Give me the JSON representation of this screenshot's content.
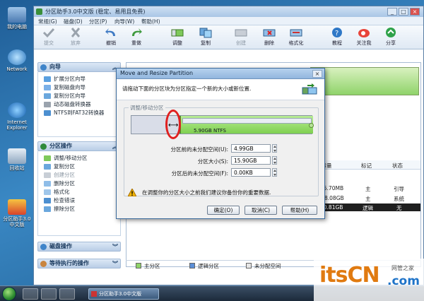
{
  "desktop": {
    "icons": [
      {
        "label": "我的电脑",
        "icon": "computer-icon"
      },
      {
        "label": "Network",
        "icon": "network-icon"
      },
      {
        "label": "Internet Explorer",
        "icon": "ie-icon"
      },
      {
        "label": "回收站",
        "icon": "recycle-bin-icon"
      },
      {
        "label": "分区助手3.0中文版",
        "icon": "partition-assistant-icon"
      }
    ]
  },
  "taskbar": {
    "app_label": "分区助手3.0中文版"
  },
  "app": {
    "title": "分区助手3.0中文版 (稳定、易用且免费)",
    "menu": [
      "常规(G)",
      "磁盘(D)",
      "分区(P)",
      "向导(W)",
      "帮助(H)"
    ],
    "toolbar": [
      {
        "label": "提交",
        "enabled": false
      },
      {
        "label": "放弃",
        "enabled": false
      },
      {
        "label": "撤销",
        "enabled": true
      },
      {
        "label": "重做",
        "enabled": true
      },
      {
        "label": "调整",
        "enabled": true
      },
      {
        "label": "复制",
        "enabled": true
      },
      {
        "label": "创建",
        "enabled": false
      },
      {
        "label": "删除",
        "enabled": true
      },
      {
        "label": "格式化",
        "enabled": true
      },
      {
        "label": "教程",
        "enabled": true
      },
      {
        "label": "关注我",
        "enabled": true
      },
      {
        "label": "分享",
        "enabled": true
      }
    ],
    "sidebar": {
      "wizard_header": "向导",
      "wizard_items": [
        "扩展分区向导",
        "复制磁盘向导",
        "复制分区向导",
        "动态磁盘转换器",
        "NTFS到FAT32转换器"
      ],
      "ops_header": "分区操作",
      "ops_items": [
        {
          "label": "调整/移动分区",
          "enabled": true
        },
        {
          "label": "复制分区",
          "enabled": true
        },
        {
          "label": "创建分区",
          "enabled": false
        },
        {
          "label": "删除分区",
          "enabled": true
        },
        {
          "label": "格式化",
          "enabled": true
        },
        {
          "label": "检查错误",
          "enabled": true
        },
        {
          "label": "擦除分区",
          "enabled": true
        }
      ],
      "disk_ops_header": "磁盘操作",
      "pending_header": "等待执行的操作"
    },
    "table": {
      "headers": [
        "用容量",
        "标记",
        "状态"
      ],
      "rows": [
        {
          "capacity": "75.70MB",
          "flag": "主",
          "status": "引导"
        },
        {
          "capacity": "8.08GB",
          "flag": "主",
          "status": "系统"
        },
        {
          "capacity": "20.81GB",
          "flag": "逻辑",
          "status": "无"
        }
      ]
    },
    "legend": [
      "主分区",
      "逻辑分区",
      "未分配空间"
    ]
  },
  "dialog": {
    "title": "Move and Resize Partition",
    "description": "请拖动下面的分区块为分区指定一个新的大小或新位置.",
    "group_label": "调整/移动分区",
    "partition_label": "5.90GB NTFS",
    "fields": [
      {
        "label": "分区前的未分配空间(U):",
        "value": "4.99GB"
      },
      {
        "label": "分区大小(S):",
        "value": "15.90GB"
      },
      {
        "label": "分区后的未分配空间(F):",
        "value": "0.00KB"
      }
    ],
    "warning": "在调整你的分区大小之前我们建议你备份你的重要数据.",
    "buttons": {
      "ok": "确定(O)",
      "cancel": "取消(C)",
      "help": "帮助(H)"
    }
  },
  "watermark": {
    "text": "itsCN",
    "sub": "网管之家",
    "com": ".com"
  }
}
